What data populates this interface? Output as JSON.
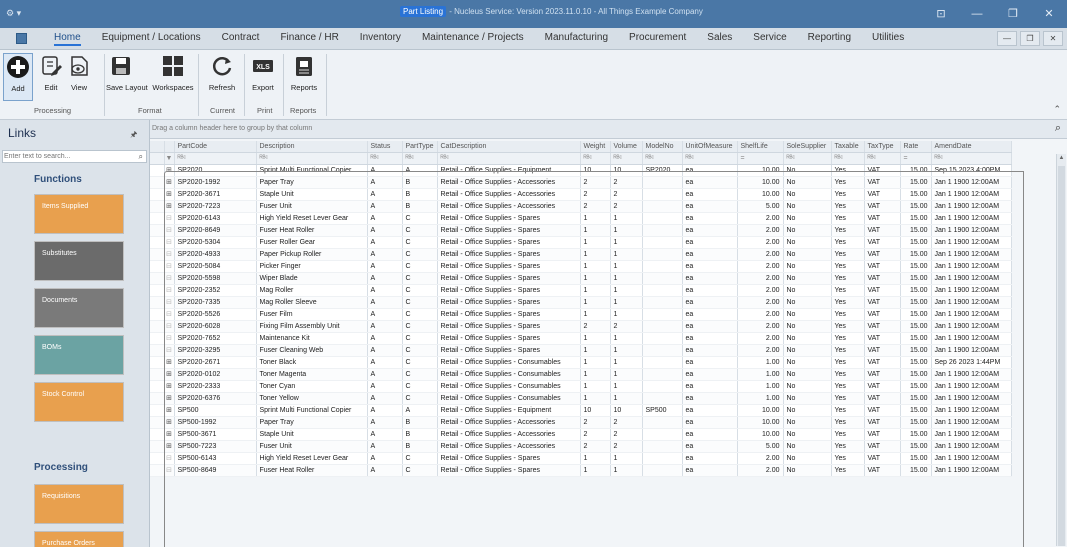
{
  "titlebar": {
    "sys_icon": "gear-icon",
    "title_highlight": "Part Listing",
    "title_rest": " - Nucleus Service: Version 2023.11.0.10 - All Things Example Company",
    "minimize": "—",
    "restore": "❐",
    "close": "✕",
    "extra": "⊡"
  },
  "menu": {
    "items": [
      "Home",
      "Equipment / Locations",
      "Contract",
      "Finance / HR",
      "Inventory",
      "Maintenance / Projects",
      "Manufacturing",
      "Procurement",
      "Sales",
      "Service",
      "Reporting",
      "Utilities"
    ],
    "mdi": [
      "—",
      "❐",
      "✕"
    ]
  },
  "ribbon": {
    "add": "Add",
    "edit": "Edit",
    "view": "View",
    "save_layout": "Save Layout",
    "workspaces": "Workspaces",
    "refresh": "Refresh",
    "export": "Export",
    "reports": "Reports",
    "xls": "XLS",
    "groups": {
      "processing": "Processing",
      "format": "Format",
      "current": "Current",
      "print": "Print",
      "reports": "Reports"
    }
  },
  "links": {
    "header": "Links",
    "search_placeholder": "Enter text to search...",
    "functions_title": "Functions",
    "functions": [
      {
        "label": "Items Supplied",
        "color": "#e8a04e"
      },
      {
        "label": "Substitutes",
        "color": "#6b6b6b"
      },
      {
        "label": "Documents",
        "color": "#7a7a7a"
      },
      {
        "label": "BOMs",
        "color": "#6ba3a3"
      },
      {
        "label": "Stock Control",
        "color": "#e8a04e"
      }
    ],
    "processing_title": "Processing",
    "processing": [
      {
        "label": "Requisitions",
        "color": "#e8a04e"
      },
      {
        "label": "Purchase Orders",
        "color": "#e8a04e"
      }
    ]
  },
  "grid": {
    "group_hint": "Drag a column header here to group by that column",
    "columns": [
      "PartCode",
      "Description",
      "Status",
      "PartType",
      "CatDescription",
      "Weight",
      "Volume",
      "ModelNo",
      "UnitOfMeasure",
      "ShelfLife",
      "SoleSupplier",
      "Taxable",
      "TaxType",
      "Rate",
      "AmendDate"
    ],
    "filter_marks": [
      "ᴿᴮᶜ",
      "ᴿᴮᶜ",
      "ᴿᴮᶜ",
      "ᴿᴮᶜ",
      "ᴿᴮᶜ",
      "ᴿᴮᶜ",
      "ᴿᴮᶜ",
      "ᴿᴮᶜ",
      "ᴿᴮᶜ",
      "=",
      "ᴿᴮᶜ",
      "ᴿᴮᶜ",
      "ᴿᴮᶜ",
      "=",
      "ᴿᴮᶜ"
    ],
    "rows": [
      [
        "SP2020",
        "Sprint Multi Functional Copier",
        "A",
        "A",
        "Retail - Office Supplies - Equipment",
        "10",
        "10",
        "SP2020",
        "ea",
        "10.00",
        "No",
        "Yes",
        "VAT",
        "15.00",
        "Sep 15 2023  4:00PM"
      ],
      [
        "SP2020-1992",
        "Paper Tray",
        "A",
        "B",
        "Retail - Office Supplies - Accessories",
        "2",
        "2",
        "",
        "ea",
        "10.00",
        "No",
        "Yes",
        "VAT",
        "15.00",
        "Jan  1 1900 12:00AM"
      ],
      [
        "SP2020-3671",
        "Staple Unit",
        "A",
        "B",
        "Retail - Office Supplies - Accessories",
        "2",
        "2",
        "",
        "ea",
        "10.00",
        "No",
        "Yes",
        "VAT",
        "15.00",
        "Jan  1 1900 12:00AM"
      ],
      [
        "SP2020-7223",
        "Fuser Unit",
        "A",
        "B",
        "Retail - Office Supplies - Accessories",
        "2",
        "2",
        "",
        "ea",
        "5.00",
        "No",
        "Yes",
        "VAT",
        "15.00",
        "Jan  1 1900 12:00AM"
      ],
      [
        "SP2020-6143",
        "High Yield Reset Lever Gear",
        "A",
        "C",
        "Retail - Office Supplies - Spares",
        "1",
        "1",
        "",
        "ea",
        "2.00",
        "No",
        "Yes",
        "VAT",
        "15.00",
        "Jan  1 1900 12:00AM"
      ],
      [
        "SP2020-8649",
        "Fuser Heat Roller",
        "A",
        "C",
        "Retail - Office Supplies - Spares",
        "1",
        "1",
        "",
        "ea",
        "2.00",
        "No",
        "Yes",
        "VAT",
        "15.00",
        "Jan  1 1900 12:00AM"
      ],
      [
        "SP2020-5304",
        "Fuser Roller Gear",
        "A",
        "C",
        "Retail - Office Supplies - Spares",
        "1",
        "1",
        "",
        "ea",
        "2.00",
        "No",
        "Yes",
        "VAT",
        "15.00",
        "Jan  1 1900 12:00AM"
      ],
      [
        "SP2020-4933",
        "Paper Pickup Roller",
        "A",
        "C",
        "Retail - Office Supplies - Spares",
        "1",
        "1",
        "",
        "ea",
        "2.00",
        "No",
        "Yes",
        "VAT",
        "15.00",
        "Jan  1 1900 12:00AM"
      ],
      [
        "SP2020-5084",
        "Picker Finger",
        "A",
        "C",
        "Retail - Office Supplies - Spares",
        "1",
        "1",
        "",
        "ea",
        "2.00",
        "No",
        "Yes",
        "VAT",
        "15.00",
        "Jan  1 1900 12:00AM"
      ],
      [
        "SP2020-5598",
        "Wiper Blade",
        "A",
        "C",
        "Retail - Office Supplies - Spares",
        "1",
        "1",
        "",
        "ea",
        "2.00",
        "No",
        "Yes",
        "VAT",
        "15.00",
        "Jan  1 1900 12:00AM"
      ],
      [
        "SP2020-2352",
        "Mag Roller",
        "A",
        "C",
        "Retail - Office Supplies - Spares",
        "1",
        "1",
        "",
        "ea",
        "2.00",
        "No",
        "Yes",
        "VAT",
        "15.00",
        "Jan  1 1900 12:00AM"
      ],
      [
        "SP2020-7335",
        "Mag Roller Sleeve",
        "A",
        "C",
        "Retail - Office Supplies - Spares",
        "1",
        "1",
        "",
        "ea",
        "2.00",
        "No",
        "Yes",
        "VAT",
        "15.00",
        "Jan  1 1900 12:00AM"
      ],
      [
        "SP2020-5526",
        "Fuser Film",
        "A",
        "C",
        "Retail - Office Supplies - Spares",
        "1",
        "1",
        "",
        "ea",
        "2.00",
        "No",
        "Yes",
        "VAT",
        "15.00",
        "Jan  1 1900 12:00AM"
      ],
      [
        "SP2020-6028",
        "Fixing Film Assembly Unit",
        "A",
        "C",
        "Retail - Office Supplies - Spares",
        "2",
        "2",
        "",
        "ea",
        "2.00",
        "No",
        "Yes",
        "VAT",
        "15.00",
        "Jan  1 1900 12:00AM"
      ],
      [
        "SP2020-7652",
        "Maintenance Kit",
        "A",
        "C",
        "Retail - Office Supplies - Spares",
        "1",
        "1",
        "",
        "ea",
        "2.00",
        "No",
        "Yes",
        "VAT",
        "15.00",
        "Jan  1 1900 12:00AM"
      ],
      [
        "SP2020-3295",
        "Fuser Cleaning Web",
        "A",
        "C",
        "Retail - Office Supplies - Spares",
        "1",
        "1",
        "",
        "ea",
        "2.00",
        "No",
        "Yes",
        "VAT",
        "15.00",
        "Jan  1 1900 12:00AM"
      ],
      [
        "SP2020-2671",
        "Toner Black",
        "A",
        "C",
        "Retail - Office Supplies - Consumables",
        "1",
        "1",
        "",
        "ea",
        "1.00",
        "No",
        "Yes",
        "VAT",
        "15.00",
        "Sep 26 2023  1:44PM"
      ],
      [
        "SP2020-0102",
        "Toner Magenta",
        "A",
        "C",
        "Retail - Office Supplies - Consumables",
        "1",
        "1",
        "",
        "ea",
        "1.00",
        "No",
        "Yes",
        "VAT",
        "15.00",
        "Jan  1 1900 12:00AM"
      ],
      [
        "SP2020-2333",
        "Toner Cyan",
        "A",
        "C",
        "Retail - Office Supplies - Consumables",
        "1",
        "1",
        "",
        "ea",
        "1.00",
        "No",
        "Yes",
        "VAT",
        "15.00",
        "Jan  1 1900 12:00AM"
      ],
      [
        "SP2020-6376",
        "Toner Yellow",
        "A",
        "C",
        "Retail - Office Supplies - Consumables",
        "1",
        "1",
        "",
        "ea",
        "1.00",
        "No",
        "Yes",
        "VAT",
        "15.00",
        "Jan  1 1900 12:00AM"
      ],
      [
        "SP500",
        "Sprint Multi Functional Copier",
        "A",
        "A",
        "Retail - Office Supplies - Equipment",
        "10",
        "10",
        "SP500",
        "ea",
        "10.00",
        "No",
        "Yes",
        "VAT",
        "15.00",
        "Jan  1 1900 12:00AM"
      ],
      [
        "SP500-1992",
        "Paper Tray",
        "A",
        "B",
        "Retail - Office Supplies - Accessories",
        "2",
        "2",
        "",
        "ea",
        "10.00",
        "No",
        "Yes",
        "VAT",
        "15.00",
        "Jan  1 1900 12:00AM"
      ],
      [
        "SP500-3671",
        "Staple Unit",
        "A",
        "B",
        "Retail - Office Supplies - Accessories",
        "2",
        "2",
        "",
        "ea",
        "10.00",
        "No",
        "Yes",
        "VAT",
        "15.00",
        "Jan  1 1900 12:00AM"
      ],
      [
        "SP500-7223",
        "Fuser Unit",
        "A",
        "B",
        "Retail - Office Supplies - Accessories",
        "2",
        "2",
        "",
        "ea",
        "5.00",
        "No",
        "Yes",
        "VAT",
        "15.00",
        "Jan  1 1900 12:00AM"
      ],
      [
        "SP500-6143",
        "High Yield Reset Lever Gear",
        "A",
        "C",
        "Retail - Office Supplies - Spares",
        "1",
        "1",
        "",
        "ea",
        "2.00",
        "No",
        "Yes",
        "VAT",
        "15.00",
        "Jan  1 1900 12:00AM"
      ],
      [
        "SP500-8649",
        "Fuser Heat Roller",
        "A",
        "C",
        "Retail - Office Supplies - Spares",
        "1",
        "1",
        "",
        "ea",
        "2.00",
        "No",
        "Yes",
        "VAT",
        "15.00",
        "Jan  1 1900 12:00AM"
      ]
    ],
    "expandable": [
      true,
      true,
      true,
      true,
      false,
      false,
      false,
      false,
      false,
      false,
      false,
      false,
      false,
      false,
      false,
      false,
      true,
      true,
      true,
      true,
      true,
      true,
      true,
      true,
      false,
      false
    ]
  }
}
